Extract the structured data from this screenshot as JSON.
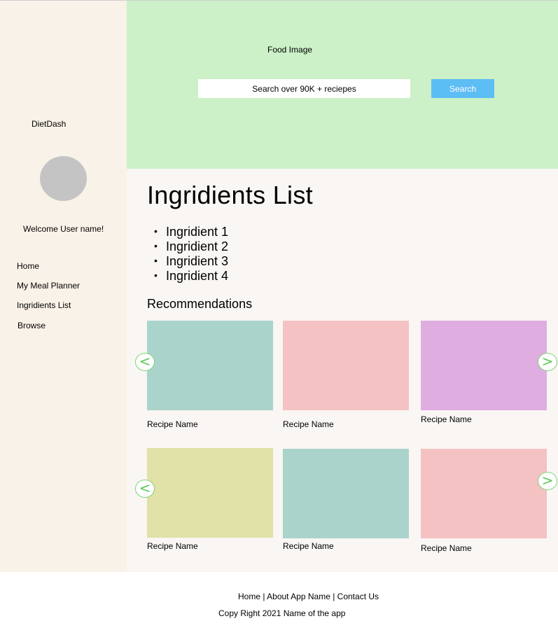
{
  "sidebar": {
    "brand": "DietDash",
    "welcome": "Welcome User name!",
    "nav": [
      "Home",
      "My Meal Planner",
      "Ingridients List",
      "Browse"
    ]
  },
  "hero": {
    "image_label": "Food Image",
    "search_placeholder": "Search over 90K + reciepes",
    "search_button": "Search"
  },
  "main": {
    "title": "Ingridients List",
    "ingredients": [
      "Ingridient 1",
      "Ingridient 2",
      "Ingridient 3",
      "Ingridient 4"
    ],
    "recommendations_title": "Recommendations",
    "rows": [
      {
        "cards": [
          {
            "name": "Recipe Name",
            "color": "#aad4cb"
          },
          {
            "name": "Recipe Name",
            "color": "#f4c2c3"
          },
          {
            "name": "Recipe Name",
            "color": "#dfade0"
          }
        ]
      },
      {
        "cards": [
          {
            "name": "Recipe Name",
            "color": "#e0e2a7"
          },
          {
            "name": "Recipe Name",
            "color": "#aad4cb"
          },
          {
            "name": "Recipe Name",
            "color": "#f4c2c3"
          }
        ]
      }
    ],
    "prev_arrow": "<",
    "next_arrow": ">"
  },
  "footer": {
    "links": [
      "Home",
      "About App Name",
      "Contact Us"
    ],
    "separator": " | ",
    "copyright": "Copy Right 2021 Name of the app"
  }
}
